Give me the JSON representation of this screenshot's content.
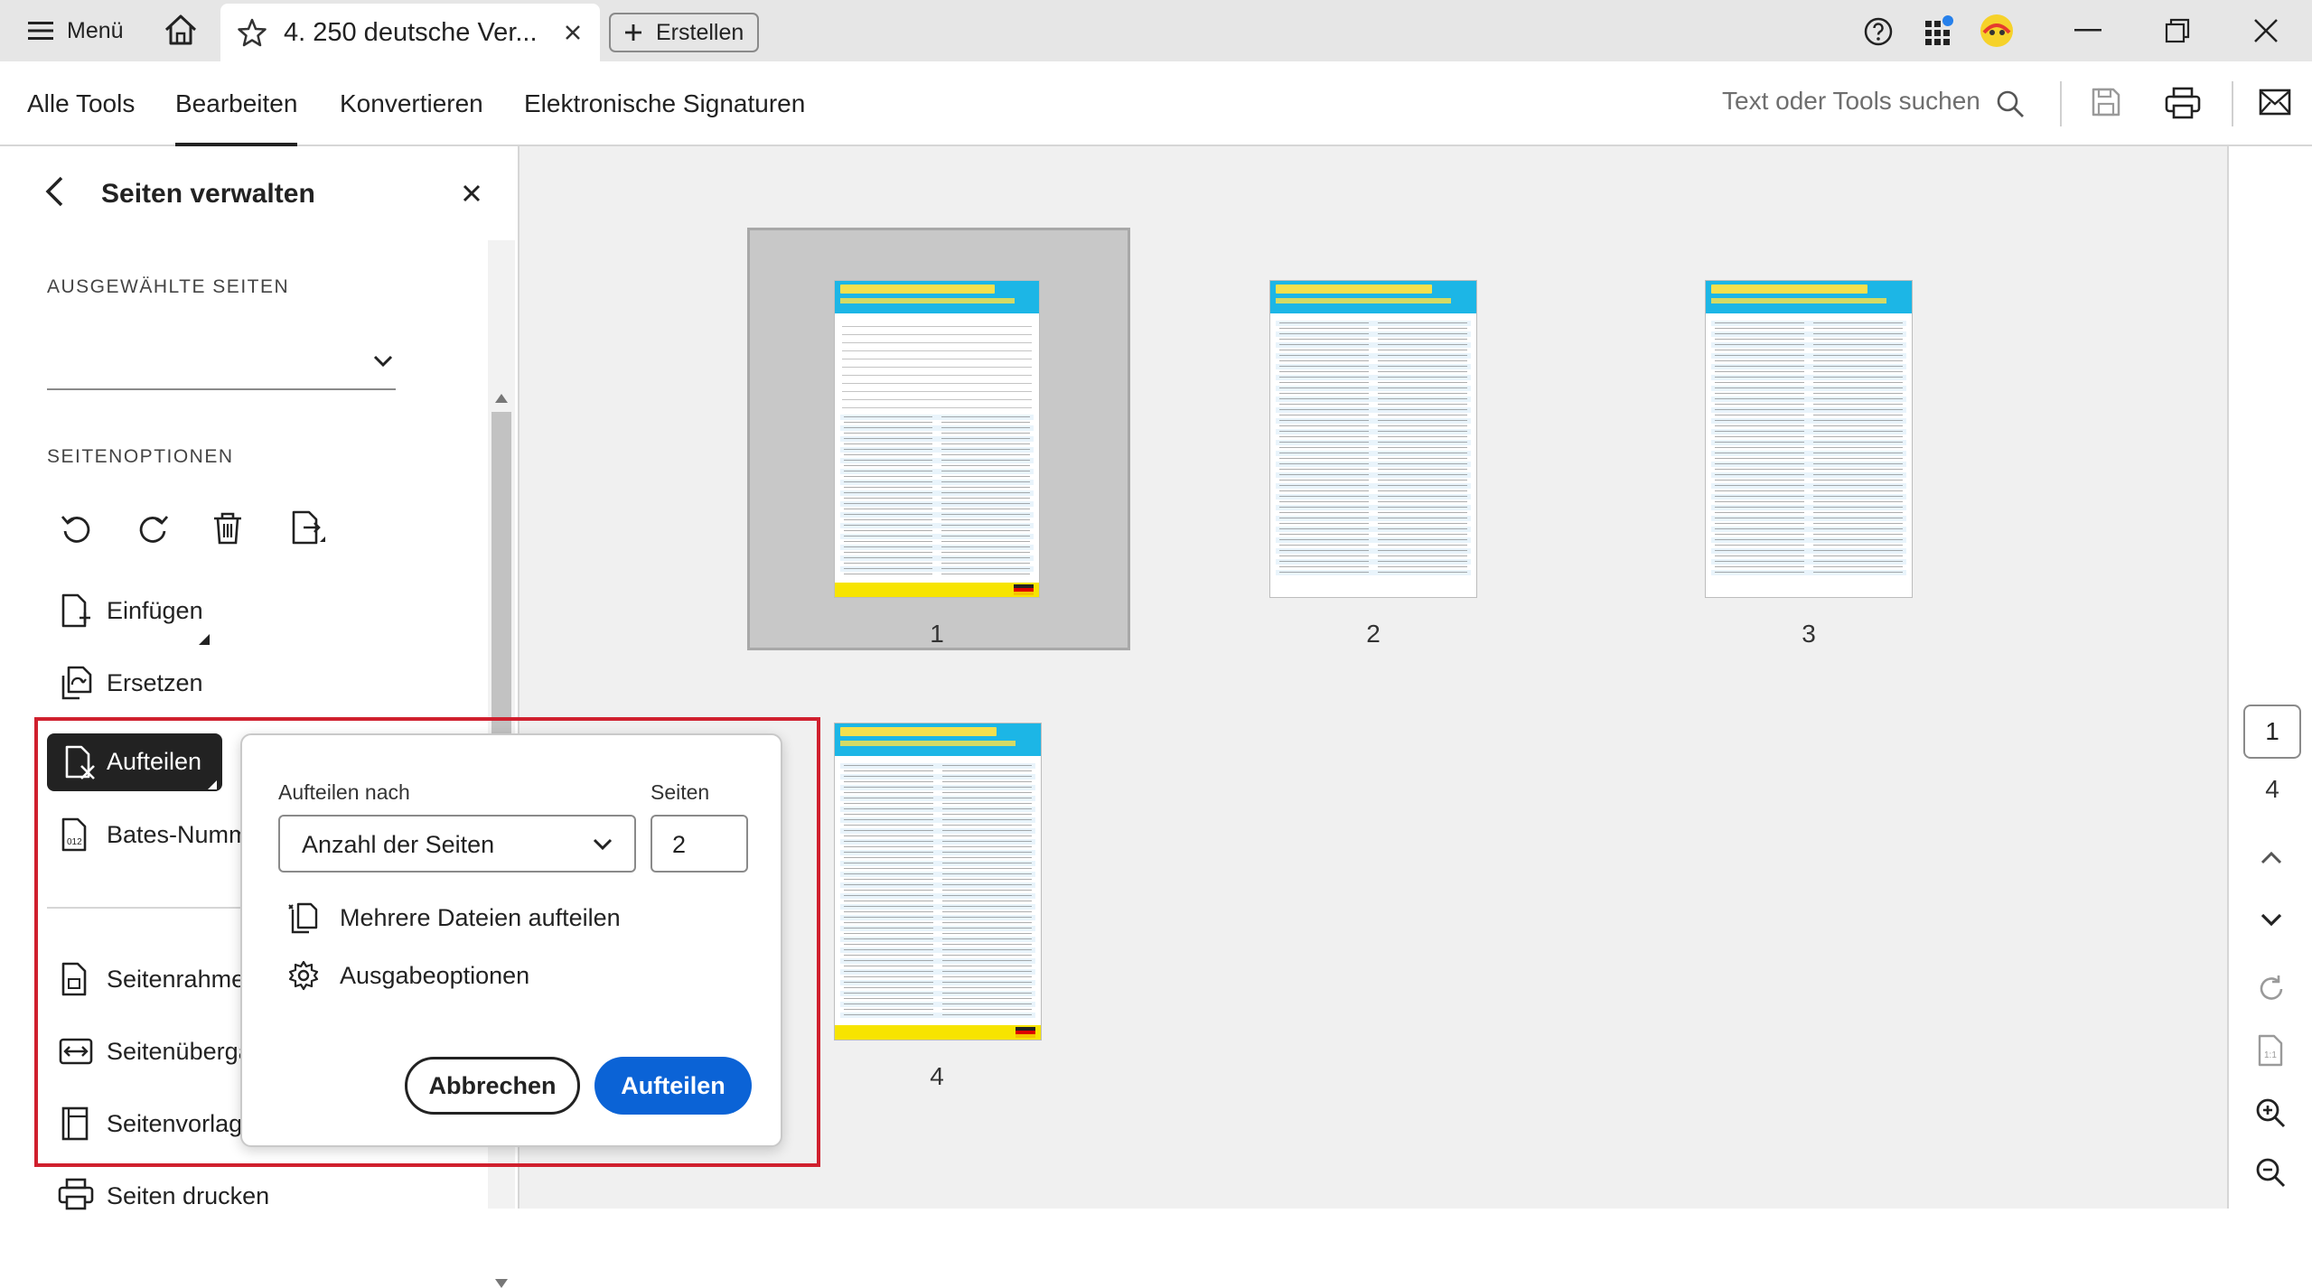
{
  "titlebar": {
    "menu_label": "Menü",
    "tab_title": "4. 250 deutsche Ver...",
    "create_label": "Erstellen"
  },
  "toolbar": {
    "tabs": [
      "Alle Tools",
      "Bearbeiten",
      "Konvertieren",
      "Elektronische Signaturen"
    ],
    "active_tab": "Bearbeiten",
    "search_placeholder": "Text oder Tools suchen"
  },
  "panel": {
    "title": "Seiten verwalten",
    "selected_pages_heading": "AUSGEWÄHLTE SEITEN",
    "page_options_heading": "SEITENOPTIONEN",
    "items": {
      "insert": "Einfügen",
      "replace": "Ersetzen",
      "split": "Aufteilen",
      "bates": "Bates-Numm",
      "page_box": "Seitenrahmen",
      "transitions": "Seitenübergä",
      "templates": "Seitenvorlage",
      "print": "Seiten drucken"
    }
  },
  "split_popup": {
    "split_by_label": "Aufteilen nach",
    "split_by_value": "Anzahl der Seiten",
    "pages_label": "Seiten",
    "pages_value": "2",
    "multi_files": "Mehrere Dateien aufteilen",
    "output_options": "Ausgabeoptionen",
    "cancel_label": "Abbrechen",
    "split_label": "Aufteilen"
  },
  "thumbnails": {
    "page_labels": [
      "1",
      "2",
      "3",
      "4"
    ],
    "header_text": "250 VERBEN MIT PRÄPOSITIONEN",
    "selected_page": "1"
  },
  "rightrail": {
    "current_page": "1",
    "total_pages": "4"
  },
  "colors": {
    "accent": "#0b63d6",
    "highlight_border": "#d0202e",
    "selected_thumb_bg": "#c8c8c8"
  }
}
